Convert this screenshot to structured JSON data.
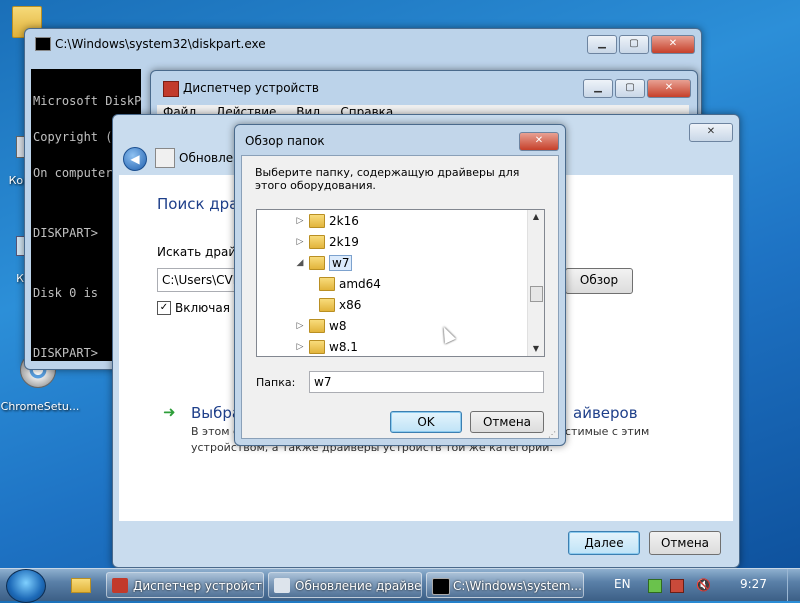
{
  "desktop": {
    "icons": [
      {
        "label": "Ком",
        "icon": "computer-icon"
      },
      {
        "label": "К",
        "icon": "recycle-bin-icon"
      },
      {
        "label": "ChromeSetu...",
        "icon": "chrome-setup-icon"
      }
    ]
  },
  "cmd_window": {
    "title": "C:\\Windows\\system32\\diskpart.exe",
    "lines": [
      "Microsoft DiskP",
      "Copyright (C) 1",
      "On computer: CV",
      "",
      "DISKPART>",
      "",
      "Disk 0 is",
      "",
      "DISKPART>"
    ]
  },
  "devmgr_window": {
    "title": "Диспетчер устройств",
    "menu": [
      "Файл",
      "Действие",
      "Вид",
      "Справка"
    ]
  },
  "wizard_window": {
    "title": "Обновлен",
    "heading": "Поиск драй",
    "search_label": "Искать драйве",
    "path_value": "C:\\Users\\CVM",
    "browse_button": "Обзор",
    "include_subfolders": "Включая вл",
    "pick_title_left": "Выбра",
    "pick_title_right": "айверов",
    "pick_desc_line1_left": "В этом с",
    "pick_desc_line1_right": "стимые с этим",
    "pick_desc_line2": "устройством, а также драйверы устройств той же категории.",
    "next_button": "Далее",
    "cancel_button": "Отмена"
  },
  "browse_dialog": {
    "title": "Обзор папок",
    "description": "Выберите папку, содержащую драйверы для этого оборудования.",
    "tree": [
      {
        "label": "2k16",
        "level": 0,
        "expander": "▷"
      },
      {
        "label": "2k19",
        "level": 0,
        "expander": "▷"
      },
      {
        "label": "w7",
        "level": 0,
        "expander": "◢",
        "selected": true
      },
      {
        "label": "amd64",
        "level": 1,
        "expander": ""
      },
      {
        "label": "x86",
        "level": 1,
        "expander": ""
      },
      {
        "label": "w8",
        "level": 0,
        "expander": "▷"
      },
      {
        "label": "w8.1",
        "level": 0,
        "expander": "▷"
      }
    ],
    "folder_label": "Папка:",
    "folder_value": "w7",
    "ok_button": "OK",
    "cancel_button": "Отмена"
  },
  "taskbar": {
    "items": [
      {
        "label": "Диспетчер устройств",
        "icon": "device-manager-icon"
      },
      {
        "label": "Обновление драйве...",
        "icon": "driver-update-icon"
      },
      {
        "label": "C:\\Windows\\system...",
        "icon": "cmd-icon"
      }
    ],
    "language": "EN",
    "clock": "9:27"
  },
  "colors": {
    "desktop": "#1e73c4",
    "title_glass": "#bcd3ea",
    "close_red": "#c6402a",
    "link_green": "#2e9e3a"
  }
}
